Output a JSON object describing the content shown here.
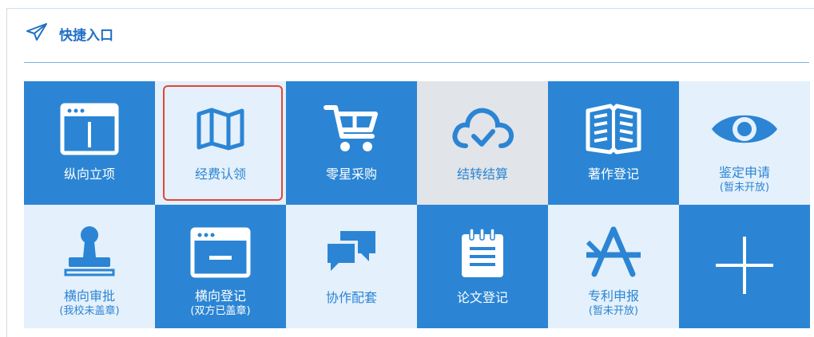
{
  "section": {
    "title": "快捷入口",
    "icon": "paper-plane-icon"
  },
  "colors": {
    "accent": "#2b85d4",
    "tile_light": "#e4f0fb",
    "tile_gray": "#e1e4e8",
    "selected_border": "#e0463a"
  },
  "tiles": [
    {
      "label": "纵向立项",
      "sub": "",
      "icon": "browser-window-icon"
    },
    {
      "label": "经费认领",
      "sub": "",
      "icon": "map-icon",
      "selected": true
    },
    {
      "label": "零星采购",
      "sub": "",
      "icon": "shopping-cart-icon"
    },
    {
      "label": "结转结算",
      "sub": "",
      "icon": "cloud-check-icon"
    },
    {
      "label": "著作登记",
      "sub": "",
      "icon": "open-book-icon"
    },
    {
      "label": "鉴定申请",
      "sub": "(暂未开放)",
      "icon": "eye-icon"
    },
    {
      "label": "横向审批",
      "sub": "(我校未盖章)",
      "icon": "stamp-icon"
    },
    {
      "label": "横向登记",
      "sub": "(双方已盖章)",
      "icon": "window-minus-icon"
    },
    {
      "label": "协作配套",
      "sub": "",
      "icon": "chat-bubbles-icon"
    },
    {
      "label": "论文登记",
      "sub": "",
      "icon": "notepad-icon"
    },
    {
      "label": "专利申报",
      "sub": "(暂未开放)",
      "icon": "app-store-icon"
    },
    {
      "label": "",
      "sub": "",
      "icon": "plus-icon"
    }
  ]
}
